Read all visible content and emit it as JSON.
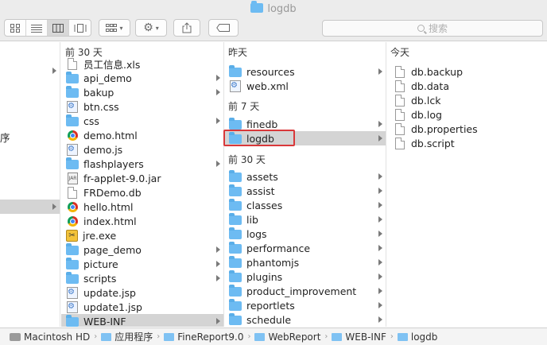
{
  "window": {
    "title": "logdb"
  },
  "toolbar": {
    "view_icons": [
      "icon-view-icon",
      "list-view-icon",
      "column-view-icon",
      "gallery-view-icon"
    ],
    "search_placeholder": "搜索"
  },
  "col0": {
    "partial_label": "序"
  },
  "col1": {
    "header": "前 30 天",
    "items": [
      {
        "name": "员工信息.xls",
        "icon": "document",
        "folder": false
      },
      {
        "name": "api_demo",
        "icon": "folder",
        "folder": true
      },
      {
        "name": "bakup",
        "icon": "folder",
        "folder": true
      },
      {
        "name": "btn.css",
        "icon": "gear-document",
        "folder": false
      },
      {
        "name": "css",
        "icon": "folder",
        "folder": true
      },
      {
        "name": "demo.html",
        "icon": "chrome",
        "folder": false
      },
      {
        "name": "demo.js",
        "icon": "gear-document",
        "folder": false
      },
      {
        "name": "flashplayers",
        "icon": "folder",
        "folder": true
      },
      {
        "name": "fr-applet-9.0.jar",
        "icon": "jar",
        "folder": false
      },
      {
        "name": "FRDemo.db",
        "icon": "document",
        "folder": false
      },
      {
        "name": "hello.html",
        "icon": "chrome",
        "folder": false
      },
      {
        "name": "index.html",
        "icon": "chrome",
        "folder": false
      },
      {
        "name": "jre.exe",
        "icon": "exe",
        "folder": false
      },
      {
        "name": "page_demo",
        "icon": "folder",
        "folder": true
      },
      {
        "name": "picture",
        "icon": "folder",
        "folder": true
      },
      {
        "name": "scripts",
        "icon": "folder",
        "folder": true
      },
      {
        "name": "update.jsp",
        "icon": "gear-document",
        "folder": false
      },
      {
        "name": "update1.jsp",
        "icon": "gear-document",
        "folder": false
      },
      {
        "name": "WEB-INF",
        "icon": "folder",
        "folder": true,
        "selected": true
      }
    ]
  },
  "col2": {
    "group_yesterday": "昨天",
    "yesterday_items": [
      {
        "name": "resources",
        "folder": true
      },
      {
        "name": "web.xml",
        "folder": false,
        "icon": "gear-document"
      }
    ],
    "group_7days": "前 7 天",
    "week_items": [
      {
        "name": "finedb",
        "folder": true
      },
      {
        "name": "logdb",
        "folder": true,
        "selected": true,
        "highlighted": true
      }
    ],
    "group_30days": "前 30 天",
    "month_items": [
      {
        "name": "assets"
      },
      {
        "name": "assist"
      },
      {
        "name": "classes"
      },
      {
        "name": "lib"
      },
      {
        "name": "logs"
      },
      {
        "name": "performance"
      },
      {
        "name": "phantomjs"
      },
      {
        "name": "plugins"
      },
      {
        "name": "product_improvement"
      },
      {
        "name": "reportlets"
      },
      {
        "name": "schedule"
      }
    ]
  },
  "col3": {
    "header": "今天",
    "items": [
      "db.backup",
      "db.data",
      "db.lck",
      "db.log",
      "db.properties",
      "db.script"
    ]
  },
  "pathbar": {
    "crumbs": [
      "Macintosh HD",
      "应用程序",
      "FineReport9.0",
      "WebReport",
      "WEB-INF",
      "logdb"
    ]
  },
  "colors": {
    "folder": "#6dbbf2",
    "selection": "#d4d4d4",
    "highlight_box": "#d9383a"
  }
}
